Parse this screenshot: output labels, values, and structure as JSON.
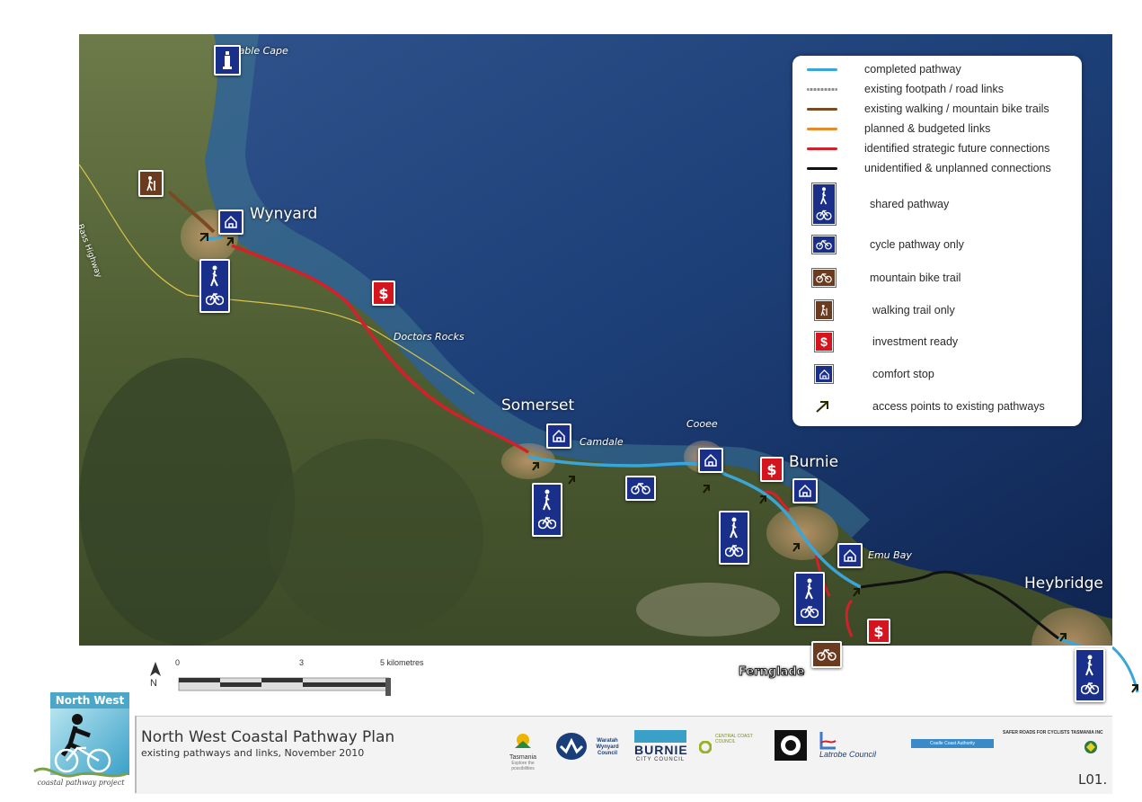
{
  "places": {
    "table_cape": "Table Cape",
    "wynyard": "Wynyard",
    "bass_highway": "Bass Highway",
    "doctors_rocks": "Doctors Rocks",
    "somerset": "Somerset",
    "camdale": "Camdale",
    "cooee": "Cooee",
    "burnie": "Burnie",
    "emu_bay": "Emu Bay",
    "heybridge": "Heybridge",
    "fernglade": "Fernglade"
  },
  "legend": {
    "items": [
      {
        "label": "completed pathway",
        "color": "#3aa6d8"
      },
      {
        "label": "existing footpath / road links",
        "color": "#8a8a8a"
      },
      {
        "label": "existing walking / mountain bike trails",
        "color": "#7a4a24"
      },
      {
        "label": "planned & budgeted links",
        "color": "#e88a2a"
      },
      {
        "label": "identified strategic future connections",
        "color": "#d4202a"
      },
      {
        "label": "unidentified & unplanned connections",
        "color": "#111111"
      },
      {
        "label": "shared pathway",
        "icon": "shared-pathway-icon"
      },
      {
        "label": "cycle pathway only",
        "icon": "bicycle-icon"
      },
      {
        "label": "mountain bike trail",
        "icon": "mountain-bike-icon"
      },
      {
        "label": "walking trail only",
        "icon": "hiker-icon"
      },
      {
        "label": "investment ready",
        "icon": "dollar-icon"
      },
      {
        "label": "comfort stop",
        "icon": "comfort-stop-icon"
      },
      {
        "label": "access points to existing pathways",
        "icon": "arrow-icon"
      }
    ]
  },
  "scale": {
    "tick_0": "0",
    "tick_3": "3",
    "tick_5": "5 kilometres",
    "north": "N"
  },
  "footer": {
    "logo_top": "North West",
    "logo_bottom": "coastal pathway project",
    "title": "North West Coastal Pathway Plan",
    "subtitle": "existing pathways and links, November 2010",
    "sheet": "L01.",
    "partners": {
      "tasmania": "Tasmania",
      "tasmania_tag": "Explore the possibilities",
      "waratah": "Waratah Wynyard Council",
      "burnie": "BURNIE",
      "burnie_tag": "CITY COUNCIL",
      "central_coast": "CENTRAL COAST COUNCIL",
      "latrobe": "Latrobe Council",
      "cradle_coast": "Cradle Coast Authority",
      "safer_roads": "SAFER ROADS FOR CYCLISTS TASMANIA INC"
    }
  },
  "colors": {
    "sea": "#1d3f78",
    "land": "#5c6a3e",
    "completed": "#3aa6d8",
    "strategic": "#d4202a",
    "unplanned": "#111111",
    "trail": "#7a4a24",
    "sign_blue": "#1a2f8a",
    "sign_red": "#d4151f"
  }
}
